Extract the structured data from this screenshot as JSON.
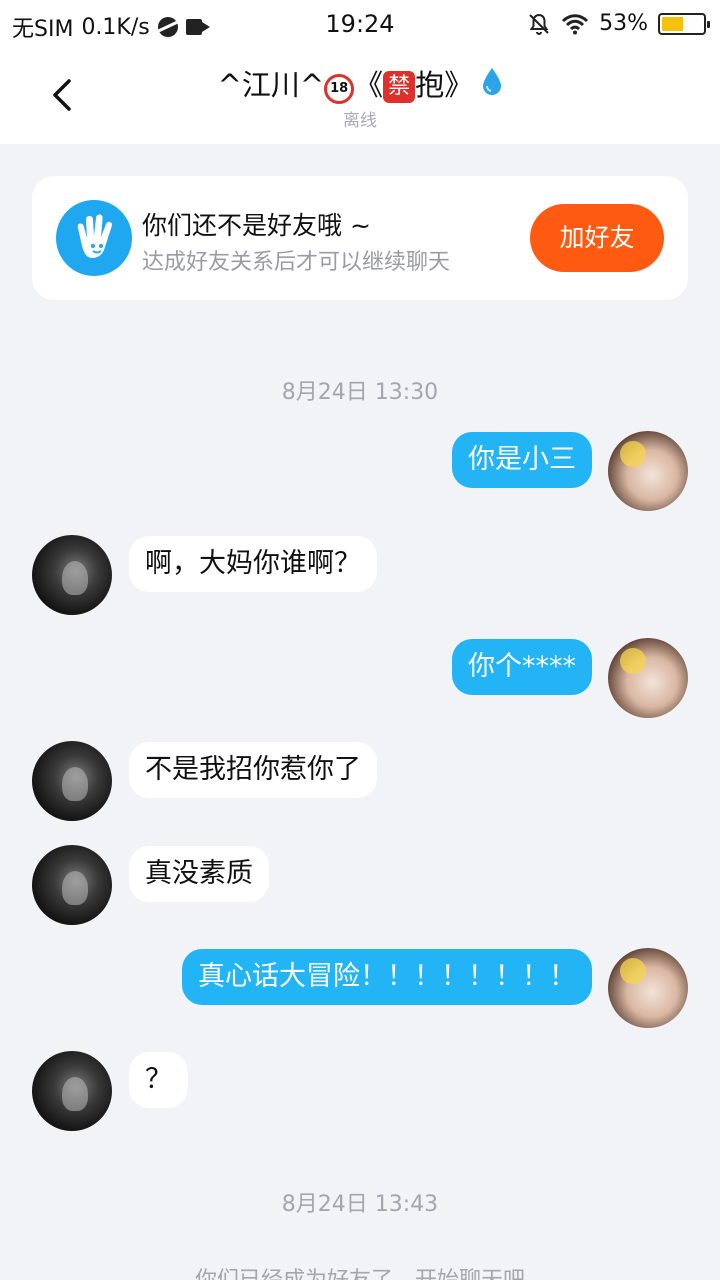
{
  "status_bar": {
    "sim": "无SIM",
    "speed": "0.1K/s",
    "time": "19:24",
    "battery": "53%",
    "battery_level": 0.53,
    "icons": [
      "globe-icon",
      "video-camera-icon",
      "mute-bell-icon",
      "wifi-icon",
      "battery-icon"
    ]
  },
  "header": {
    "title_prefix": "^江川^",
    "title_badge_18": "18",
    "title_bracket_open": "《",
    "title_badge_ban": "禁",
    "title_text": "抱",
    "title_bracket_close": "》",
    "status": "离线"
  },
  "friend_notice": {
    "title": "你们还不是好友哦 ~",
    "subtitle": "达成好友关系后才可以继续聊天",
    "button": "加好友"
  },
  "timestamps": [
    "8月24日 13:30",
    "8月24日 13:43"
  ],
  "messages": [
    {
      "from": "me",
      "text": "你是小三"
    },
    {
      "from": "them",
      "text": "啊，大妈你谁啊？"
    },
    {
      "from": "me",
      "text": "你个****"
    },
    {
      "from": "them",
      "text": "不是我招你惹你了"
    },
    {
      "from": "them",
      "text": "真没素质"
    },
    {
      "from": "me",
      "text": "真心话大冒险！！！！！！！！"
    },
    {
      "from": "them",
      "text": "？"
    }
  ],
  "system_message": "你们已经成为好友了，开始聊天吧",
  "colors": {
    "background": "#f2f3f7",
    "my_bubble": "#22b4f5",
    "their_bubble": "#ffffff",
    "add_button": "#ff5a12",
    "notice_icon": "#1fa8f0"
  }
}
